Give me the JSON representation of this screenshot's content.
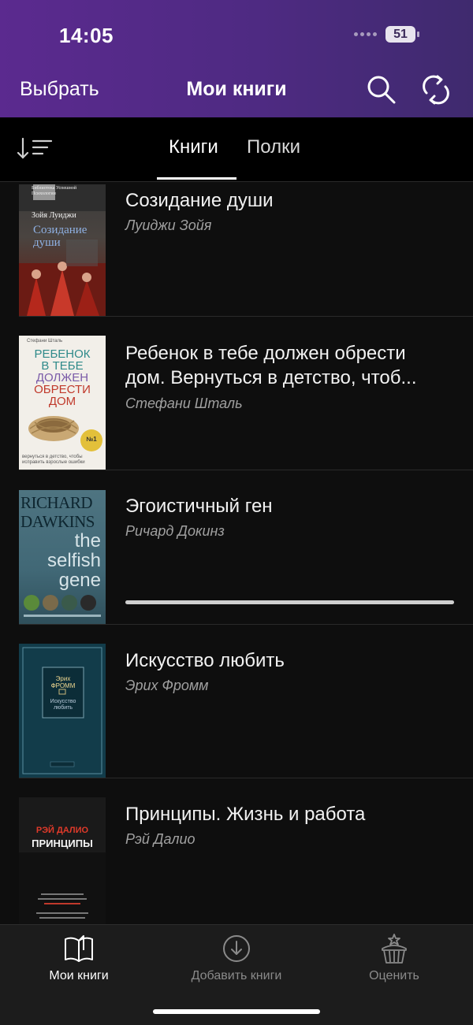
{
  "status_bar": {
    "time": "14:05",
    "battery": "51"
  },
  "nav": {
    "select_label": "Выбрать",
    "title": "Мои книги",
    "search_icon": "search-icon",
    "sync_icon": "sync-icon"
  },
  "tabs": [
    {
      "label": "Книги",
      "active": true
    },
    {
      "label": "Полки",
      "active": false
    }
  ],
  "books": [
    {
      "title": "Созидание души",
      "author": "Луиджи Зойя",
      "cover": {
        "series": "Библиотека Успешной Психологии",
        "author": "Зойя Луиджи",
        "title": "Созидание души"
      }
    },
    {
      "title": "Ребенок в тебе должен обрести дом. Вернуться в детство, чтоб...",
      "author": "Стефани Шталь",
      "cover": {
        "author": "Стефани Шталь",
        "l1": "РЕБЕНОК",
        "l2": "В ТЕБЕ",
        "l3": "ДОЛЖЕН",
        "l4": "ОБРЕСТИ",
        "l5": "ДОМ",
        "badge": "№1",
        "subtitle": "вернуться в детство, чтобы исправить взрослые ошибки"
      }
    },
    {
      "title": "Эгоистичный ген",
      "author": "Ричард Докинз",
      "progress": 1.0,
      "cover": {
        "a1": "RICHARD",
        "a2": "DAWKINS",
        "t1": "the",
        "t2": "selfish",
        "t3": "gene"
      }
    },
    {
      "title": "Искусство любить",
      "author": "Эрих Фромм",
      "cover": {
        "a1": "Эрих",
        "a2": "ФРОММ",
        "t1": "Искусство",
        "t2": "любить"
      }
    },
    {
      "title": "Принципы. Жизнь и работа",
      "author": "Рэй Далио",
      "cover": {
        "author": "РЭЙ ДАЛИО",
        "title": "ПРИНЦИПЫ"
      }
    }
  ],
  "bottom_nav": [
    {
      "label": "Мои книги",
      "icon": "book-open-icon",
      "active": true
    },
    {
      "label": "Добавить книги",
      "icon": "download-icon",
      "active": false
    },
    {
      "label": "Оценить",
      "icon": "cupcake-star-icon",
      "active": false
    }
  ],
  "colors": {
    "header_start": "#5b2a8f",
    "header_end": "#3f2a6e",
    "background": "#0e0e0e"
  }
}
